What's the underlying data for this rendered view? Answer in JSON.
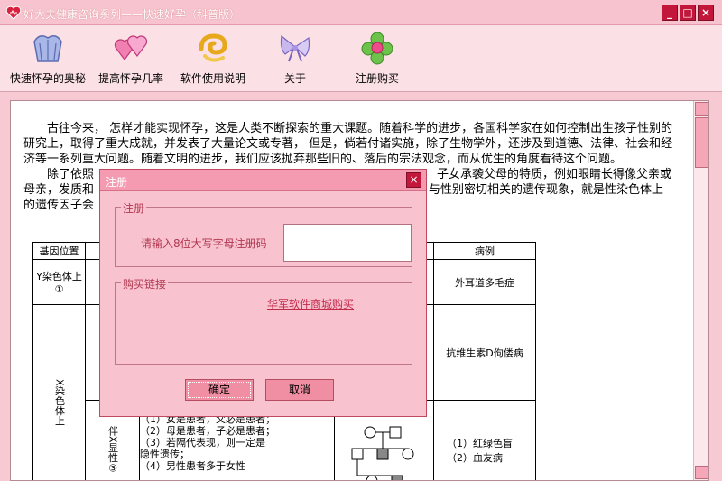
{
  "window": {
    "title": "好大夫健康咨询系列——快速好孕（科普版）",
    "controls": [
      "_",
      "□",
      "×"
    ]
  },
  "toolbar": {
    "items": [
      {
        "label": "快速怀孕的奥秘",
        "icon": "shell-icon"
      },
      {
        "label": "提高怀孕几率",
        "icon": "hearts-icon"
      },
      {
        "label": "软件使用说明",
        "icon": "swirl-icon"
      },
      {
        "label": "关于",
        "icon": "bow-icon"
      },
      {
        "label": "注册购买",
        "icon": "flower-icon"
      }
    ]
  },
  "document": {
    "para1": "古往今来， 怎样才能实现怀孕，这是人类不断探索的重大课题。随着科学的进步，各国科学家在如何控制出生孩子性别的研究上，取得了重大成就，并发表了大量论文或专著， 但是，倘若付诸实施，除了生物学外，还涉及到道德、法律、社会和经济等一系列重大问题。随着文明的进步，我们应该抛弃那些旧的、落后的宗法观念，而从优生的角度看待这个问题。",
    "para2a": "除了依照",
    "para2b": "子女承袭父母的特质，例如眼睛长得像父亲或",
    "para2c": "母亲，发质和",
    "para2d": "与性别密切相关的遗传现象，就是性染色体上",
    "para2e": "的遗传因子会",
    "table": {
      "headers": {
        "gene_position": "基因位置",
        "cases": "病例"
      },
      "y_chromosome": "Y染色体上①",
      "y_case": "外耳道多毛症",
      "x_chromosome": "X染色体上",
      "x_case_dominant": "抗维生素D佝偻病",
      "x_recessive_label": "伴X显性③",
      "x_recessive_notes": [
        "（1）女是患者，父必是患者；",
        "（2）母是患者，子必是患者；",
        "（3）若隔代表现，则一定是",
        "隐性遗传；",
        "（4）男性患者多于女性"
      ],
      "x_recessive_cases": [
        "（1）红绿色盲",
        "（2）血友病"
      ]
    }
  },
  "dialog": {
    "title": "注册",
    "register_legend": "注册",
    "register_prompt": "请输入8位大写字母注册码",
    "register_value": "",
    "buy_legend": "购买链接",
    "buy_link": "华军软件商城购买",
    "ok_label": "确定",
    "cancel_label": "取消"
  },
  "colors": {
    "accent": "#c2163a",
    "background": "#f7c9d3",
    "dialog": "#f9c2cf",
    "link": "#c22a4a"
  }
}
